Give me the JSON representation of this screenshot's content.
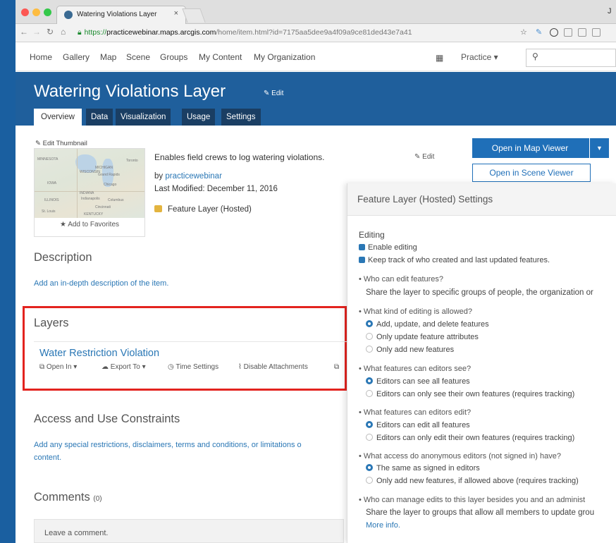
{
  "browser": {
    "tab_title": "Watering Violations Layer",
    "tab_close": "×",
    "corner_letter": "J",
    "url_https": "https://",
    "url_host": "practicewebinar.maps.arcgis.com",
    "url_path": "/home/item.html?id=7175aa5dee9a4f09a9ce81ded43e7a41"
  },
  "topnav": {
    "items": [
      "Home",
      "Gallery",
      "Map",
      "Scene",
      "Groups",
      "My Content",
      "My Organization"
    ],
    "account": "Practice ▾",
    "grid_icon": "grid-icon",
    "search_icon": "search-icon"
  },
  "banner": {
    "title": "Watering Violations Layer",
    "edit": "Edit",
    "tabs": [
      "Overview",
      "Data",
      "Visualization",
      "Usage",
      "Settings"
    ]
  },
  "item": {
    "edit_thumbnail": "Edit Thumbnail",
    "add_favorites": "Add to Favorites",
    "description": "Enables field crews to log watering violations.",
    "edit": "Edit",
    "by_label": "by",
    "owner": "practicewebinar",
    "modified": "Last Modified: December 11, 2016",
    "type": "Feature Layer (Hosted)",
    "open_map_viewer": "Open in Map Viewer",
    "open_scene_viewer": "Open in Scene Viewer",
    "map_labels": [
      "MINNESOTA",
      "WISCONSIN",
      "MICHIGAN",
      "Grand Rapids",
      "Chicago",
      "IOWA",
      "ILLINOIS",
      "INDIANA",
      "Indianapolis",
      "Columbus",
      "Cincinnati",
      "St. Louis",
      "KENTUCKY",
      "Toronto"
    ]
  },
  "sections": {
    "description_title": "Description",
    "description_link": "Add an in-depth description of the item.",
    "layers_title": "Layers",
    "layer_name": "Water Restriction Violation",
    "layer_tools": [
      "Open In ▾",
      "Export To ▾",
      "Time Settings",
      "Disable Attachments"
    ],
    "access_title": "Access and Use Constraints",
    "access_link_1": "Add any special restrictions, disclaimers, terms and conditions, or limitations o",
    "access_link_2": "content.",
    "comments_title": "Comments",
    "comments_count": "(0)",
    "comment_placeholder": "Leave a comment."
  },
  "panel": {
    "title": "Feature Layer (Hosted) Settings",
    "editing": "Editing",
    "enable_editing": "Enable editing",
    "keep_track": "Keep track of who created and last updated features.",
    "q1": "• Who can edit features?",
    "q1_text": "Share the layer to specific groups of people, the organization or",
    "q2": "• What kind of editing is allowed?",
    "q2_opts": [
      "Add, update, and delete features",
      "Only update feature attributes",
      "Only add new features"
    ],
    "q3": "• What features can editors see?",
    "q3_opts": [
      "Editors can see all features",
      "Editors can only see their own features (requires tracking)"
    ],
    "q4": "• What features can editors edit?",
    "q4_opts": [
      "Editors can edit all features",
      "Editors can only edit their own features (requires tracking)"
    ],
    "q5": "• What access do anonymous editors (not signed in) have?",
    "q5_opts": [
      "The same as signed in editors",
      "Only add new features, if allowed above (requires tracking)"
    ],
    "q6": "• Who can manage edits to this layer besides you and an administ",
    "q6_text": "Share the layer to groups that allow all members to update grou",
    "more_info": "More info."
  },
  "colors": {
    "banner": "#1f5f9c",
    "accent": "#2a77b5",
    "highlight": "#e3231f"
  }
}
